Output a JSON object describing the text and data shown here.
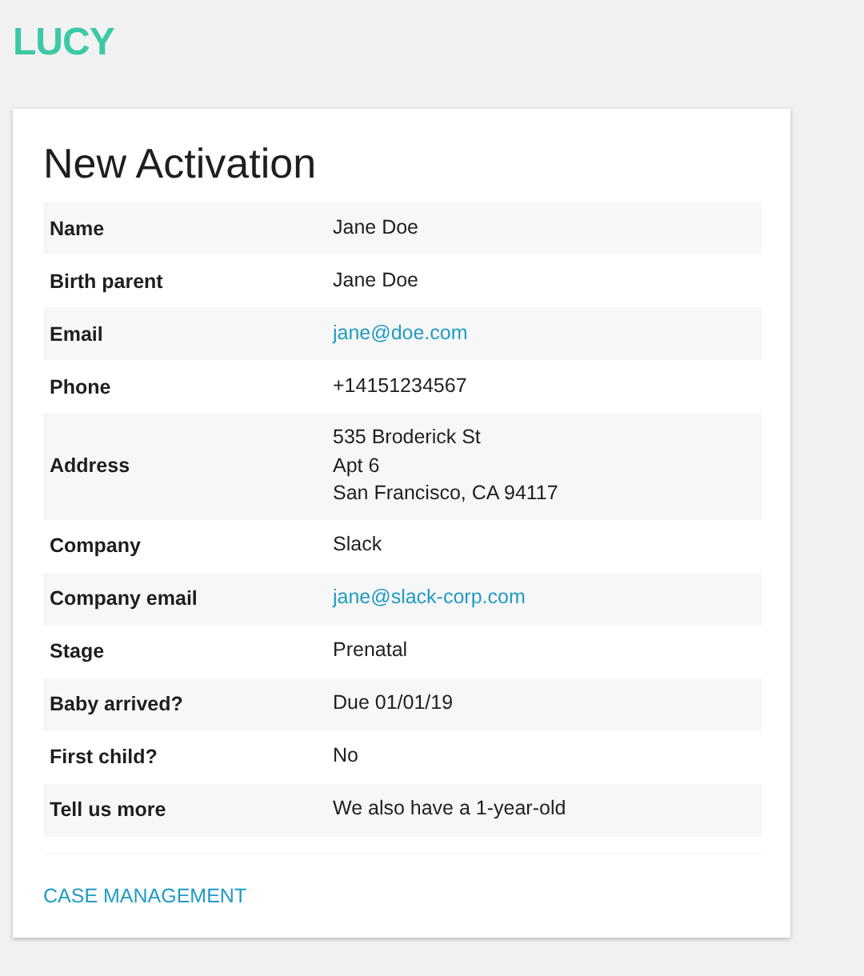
{
  "logo": "LUCY",
  "card": {
    "title": "New Activation",
    "rows": [
      {
        "label": "Name",
        "kind": "text",
        "lines": [
          "Jane Doe"
        ]
      },
      {
        "label": "Birth parent",
        "kind": "text",
        "lines": [
          "Jane Doe"
        ]
      },
      {
        "label": "Email",
        "kind": "link",
        "lines": [
          "jane@doe.com"
        ]
      },
      {
        "label": "Phone",
        "kind": "text",
        "lines": [
          "+14151234567"
        ]
      },
      {
        "label": "Address",
        "kind": "text",
        "lines": [
          "535 Broderick St",
          "Apt 6",
          "San Francisco, CA 94117"
        ]
      },
      {
        "label": "Company",
        "kind": "text",
        "lines": [
          "Slack"
        ]
      },
      {
        "label": "Company email",
        "kind": "link",
        "lines": [
          "jane@slack-corp.com"
        ]
      },
      {
        "label": "Stage",
        "kind": "text",
        "lines": [
          "Prenatal"
        ]
      },
      {
        "label": "Baby arrived?",
        "kind": "text",
        "lines": [
          "Due 01/01/19"
        ]
      },
      {
        "label": "First child?",
        "kind": "text",
        "lines": [
          "No"
        ]
      },
      {
        "label": "Tell us more",
        "kind": "text",
        "lines": [
          "We also have a 1-year-old"
        ]
      }
    ],
    "action": "CASE MANAGEMENT"
  }
}
